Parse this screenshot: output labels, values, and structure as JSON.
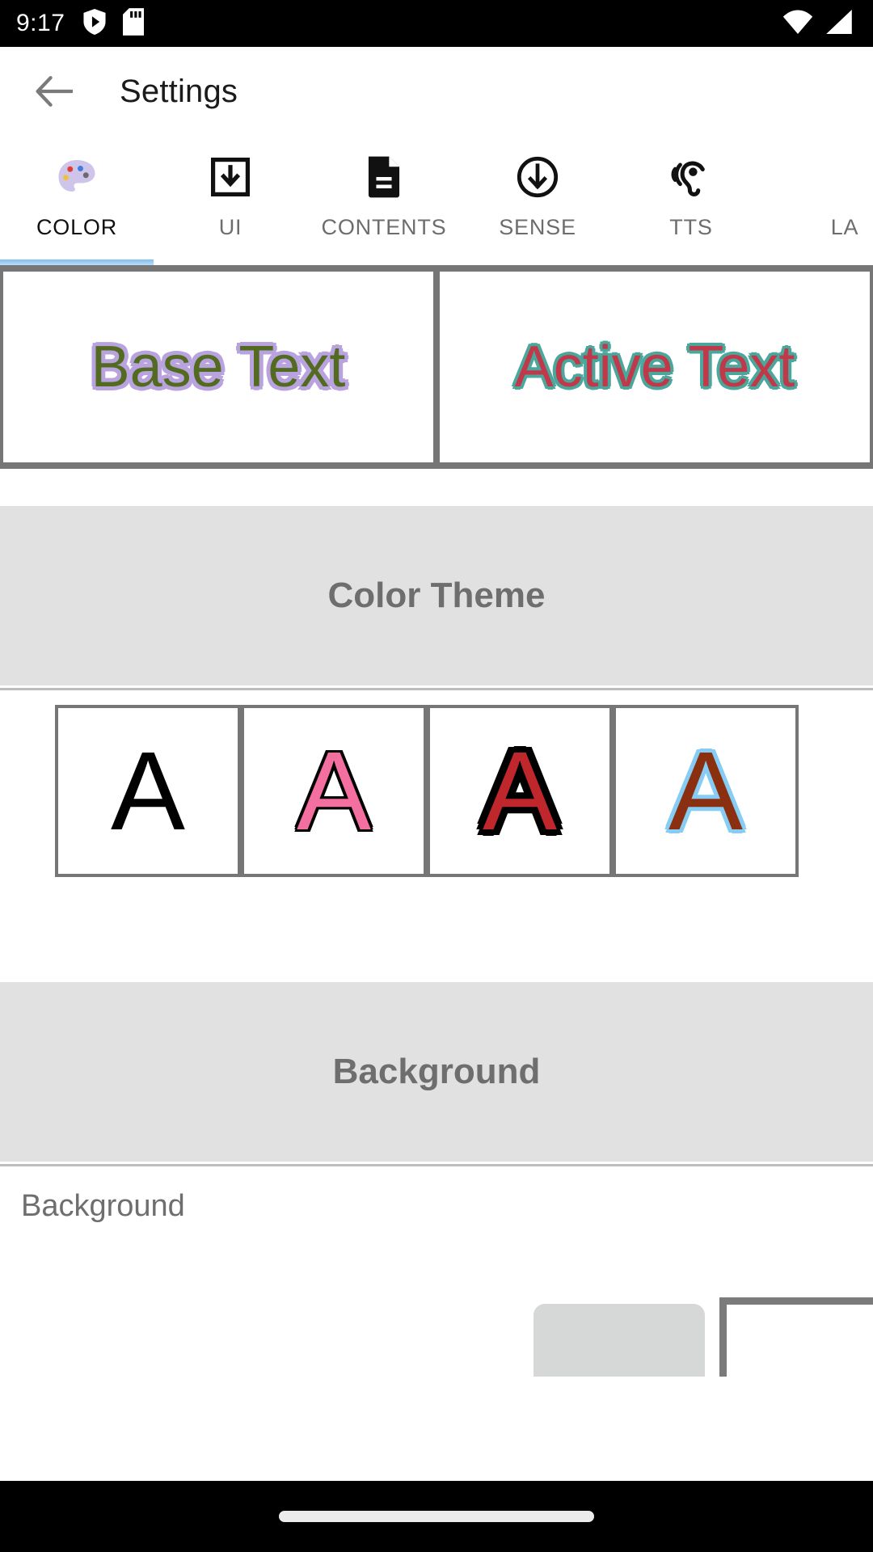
{
  "status_bar": {
    "time": "9:17",
    "left_icons": [
      "play-protect-shield-icon",
      "sd-card-icon"
    ],
    "right_icons": [
      "wifi-icon",
      "cellular-signal-icon"
    ]
  },
  "app_bar": {
    "back_icon": "back-arrow-icon",
    "title": "Settings"
  },
  "tabs": {
    "active_index": 0,
    "items": [
      {
        "label": "COLOR",
        "icon": "color-palette-icon"
      },
      {
        "label": "UI",
        "icon": "download-box-icon"
      },
      {
        "label": "CONTENTS",
        "icon": "document-icon"
      },
      {
        "label": "SENSE",
        "icon": "circle-down-arrow-icon"
      },
      {
        "label": "TTS",
        "icon": "hearing-ear-icon"
      },
      {
        "label": "LA",
        "icon": ""
      }
    ]
  },
  "preview": {
    "base": {
      "text": "Base Text",
      "fg_color": "#536b21",
      "outline_color": "#b9a3de"
    },
    "active": {
      "text": "Active Text",
      "fg_color": "#c0394b",
      "outline_color": "#4ba79b"
    }
  },
  "sections": {
    "color_theme": {
      "title": "Color Theme",
      "swatches": [
        {
          "letter": "A",
          "fg_color": "#000000",
          "outline_color": ""
        },
        {
          "letter": "A",
          "fg_color": "#f26fa0",
          "outline_color": "#000000"
        },
        {
          "letter": "A",
          "fg_color": "#c0272d",
          "outline_color": "#000000"
        },
        {
          "letter": "A",
          "fg_color": "#8a3010",
          "outline_color": "#86cdf5"
        }
      ]
    },
    "background": {
      "title": "Background",
      "row_label": "Background"
    }
  },
  "nav_bar": {
    "gesture_pill": "home-gesture-pill"
  }
}
